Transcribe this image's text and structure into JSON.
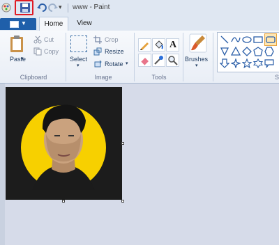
{
  "titlebar": {
    "title": "www - Paint"
  },
  "tabs": {
    "home": "Home",
    "view": "View"
  },
  "clipboard": {
    "paste": "Paste",
    "cut": "Cut",
    "copy": "Copy",
    "group": "Clipboard"
  },
  "image": {
    "select": "Select",
    "crop": "Crop",
    "resize": "Resize",
    "rotate": "Rotate",
    "group": "Image"
  },
  "tools": {
    "group": "Tools",
    "text_tool": "A"
  },
  "brushes": {
    "label": "Brushes"
  },
  "shapes": {
    "group": "S"
  },
  "colors": {
    "accent": "#1f5faa",
    "highlight": "#e01b24",
    "portrait_circle": "#f7d000"
  }
}
